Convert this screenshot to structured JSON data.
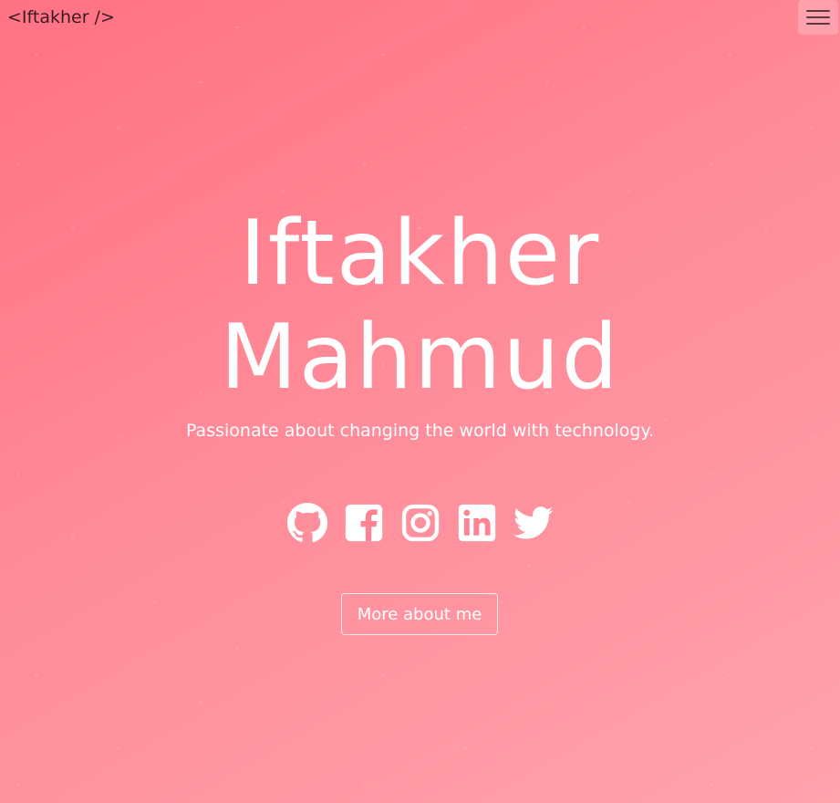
{
  "navbar": {
    "brand": "<Iftakher />",
    "menu_icon": "hamburger-menu-icon"
  },
  "hero": {
    "first_name": "Iftakher",
    "last_name": "Mahmud",
    "tagline": "Passionate about changing the world with technology.",
    "cta_label": "More about me"
  },
  "socials": [
    {
      "icon": "github-icon"
    },
    {
      "icon": "facebook-icon"
    },
    {
      "icon": "instagram-icon"
    },
    {
      "icon": "linkedin-icon"
    },
    {
      "icon": "twitter-icon"
    }
  ],
  "colors": {
    "gradient_start": "#ff7284",
    "gradient_end": "#ffa3ad",
    "text": "#ffffff"
  }
}
